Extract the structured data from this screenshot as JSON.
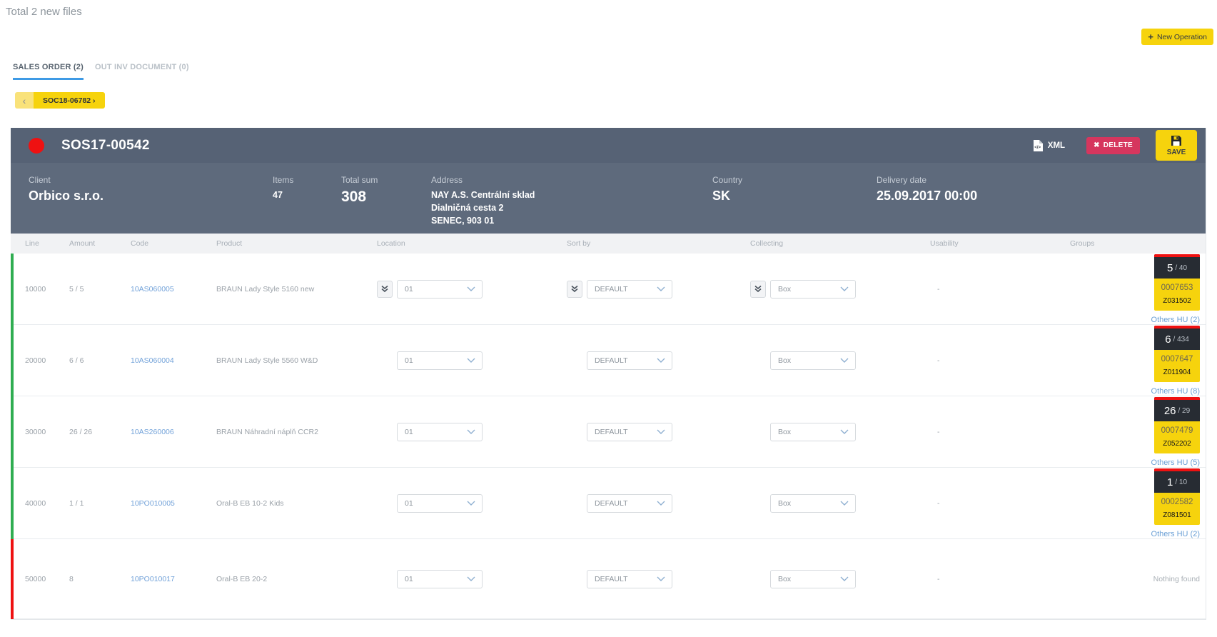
{
  "header": {
    "total_files": "Total 2 new files",
    "new_operation_label": "New Operation"
  },
  "tabs": [
    {
      "label": "SALES ORDER (2)",
      "active": true
    },
    {
      "label": "OUT INV DOCUMENT (0)",
      "active": false
    }
  ],
  "doc_nav": {
    "prev_label": "‹",
    "current_label": "SOC18-06782 ›"
  },
  "order": {
    "id": "SOS17-00542",
    "actions": {
      "xml": "XML",
      "delete": "DELETE",
      "save": "SAVE"
    },
    "info": [
      {
        "label": "Client",
        "value": "Orbico s.r.o."
      },
      {
        "label": "Items",
        "value": "47"
      },
      {
        "label": "Total sum",
        "value": "308"
      },
      {
        "label": "Address",
        "value": "NAY A.S. Centrální sklad\nDialničná cesta 2\nSENEC, 903 01"
      },
      {
        "label": "Country",
        "value": "SK"
      },
      {
        "label": "Delivery date",
        "value": "25.09.2017 00:00"
      }
    ]
  },
  "table": {
    "columns": [
      "Line",
      "Amount",
      "Code",
      "Product",
      "Location",
      "Sort by",
      "Collecting",
      "Usability",
      "Groups"
    ],
    "rows": [
      {
        "line": "10000",
        "amount": "5 / 5",
        "code": "10AS060005",
        "product": "BRAUN Lady Style 5160 new",
        "location": "01",
        "sort_by": "DEFAULT",
        "collecting": "Box",
        "usability": "-",
        "status_color": "#2fad51",
        "quick_buttons": true,
        "hu": {
          "count": "5",
          "of": "/ 40",
          "code": "0007653",
          "zcode": "Z031502",
          "others": "Others HU (2)"
        }
      },
      {
        "line": "20000",
        "amount": "6 / 6",
        "code": "10AS060004",
        "product": "BRAUN Lady Style 5560 W&D",
        "location": "01",
        "sort_by": "DEFAULT",
        "collecting": "Box",
        "usability": "-",
        "status_color": "#2fad51",
        "quick_buttons": false,
        "hu": {
          "count": "6",
          "of": "/ 434",
          "code": "0007647",
          "zcode": "Z011904",
          "others": "Others HU (8)"
        }
      },
      {
        "line": "30000",
        "amount": "26 / 26",
        "code": "10AS260006",
        "product": "BRAUN Náhradní náplň CCR2",
        "location": "01",
        "sort_by": "DEFAULT",
        "collecting": "Box",
        "usability": "-",
        "status_color": "#2fad51",
        "quick_buttons": false,
        "hu": {
          "count": "26",
          "of": "/ 29",
          "code": "0007479",
          "zcode": "Z052202",
          "others": "Others HU (5)"
        }
      },
      {
        "line": "40000",
        "amount": "1 / 1",
        "code": "10PO010005",
        "product": "Oral-B EB 10-2 Kids",
        "location": "01",
        "sort_by": "DEFAULT",
        "collecting": "Box",
        "usability": "-",
        "status_color": "#2fad51",
        "quick_buttons": false,
        "hu": {
          "count": "1",
          "of": "/ 10",
          "code": "0002582",
          "zcode": "Z081501",
          "others": "Others HU (2)"
        }
      },
      {
        "line": "50000",
        "amount": "8",
        "code": "10PO010017",
        "product": "Oral-B EB 20-2",
        "location": "01",
        "sort_by": "DEFAULT",
        "collecting": "Box",
        "usability": "-",
        "status_color": "#ee1111",
        "quick_buttons": false,
        "hu": null,
        "empty_text": "Nothing found"
      }
    ]
  },
  "colors": {
    "accent_yellow": "#f6d30d",
    "delete_red": "#d6365e",
    "status_green": "#2fad51",
    "status_red": "#ee1111",
    "tab_underline_blue": "#3e9ae5",
    "link_blue": "#72a2d9",
    "title_bar": "#566275",
    "info_bar": "#5e6a7c",
    "hu_dark": "#272c33"
  }
}
